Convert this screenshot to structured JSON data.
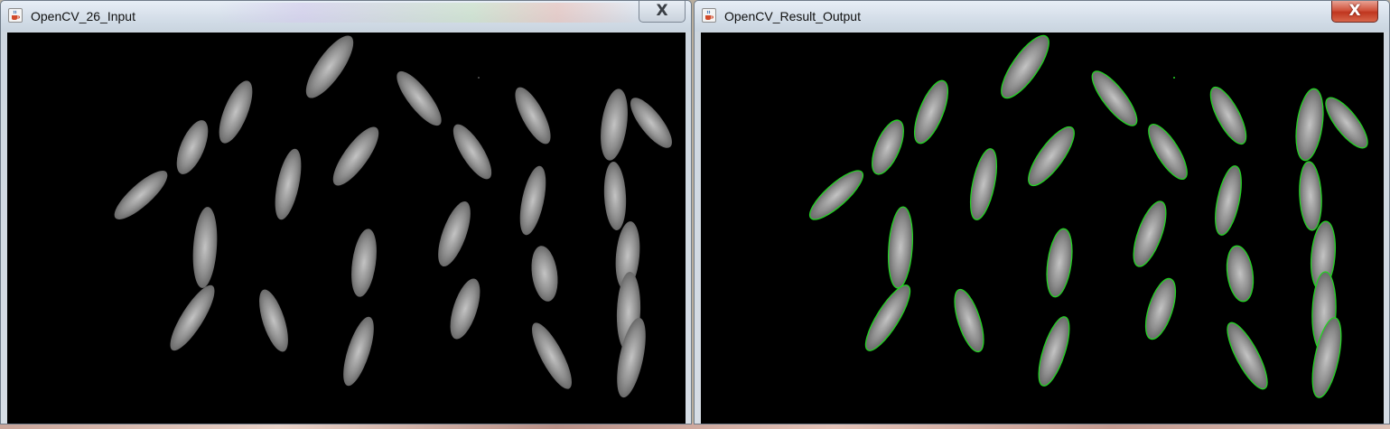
{
  "windows": [
    {
      "title": "OpenCV_26_Input",
      "close_label": "X",
      "image_role": "input-image"
    },
    {
      "title": "OpenCV_Result_Output",
      "close_label": "X",
      "image_role": "contour-result-image"
    }
  ],
  "colors": {
    "canvas_background": "#000000",
    "grain_fill": "#8a8a8a",
    "contour_stroke": "#22d422",
    "close_active": "#c9412a"
  },
  "icons": {
    "app": "java-coffee-cup-icon",
    "close": "close-icon"
  }
}
